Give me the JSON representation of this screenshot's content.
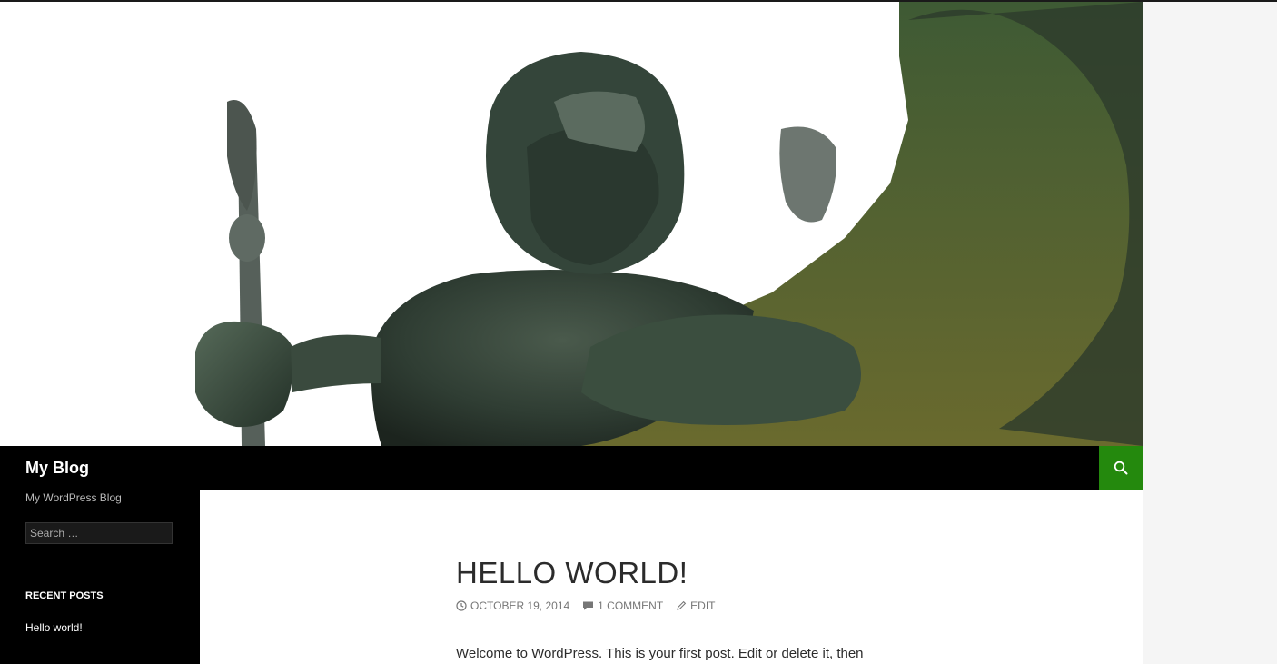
{
  "site": {
    "title": "My Blog",
    "description": "My WordPress Blog"
  },
  "masthead": {
    "search_icon": "search-icon",
    "accent_color": "#24890d"
  },
  "sidebar": {
    "search": {
      "placeholder": "Search …"
    },
    "recent_posts": {
      "title": "RECENT POSTS",
      "items": [
        {
          "label": "Hello world!"
        }
      ]
    }
  },
  "post": {
    "title": "HELLO WORLD!",
    "meta": {
      "date": "OCTOBER 19, 2014",
      "date_icon": "clock-icon",
      "comments": "1 COMMENT",
      "comments_icon": "comment-bubble-icon",
      "edit": "EDIT",
      "edit_icon": "pencil-icon"
    },
    "excerpt": "Welcome to WordPress. This is your first post. Edit or delete it, then"
  },
  "header_image": {
    "subject": "statue-image"
  }
}
